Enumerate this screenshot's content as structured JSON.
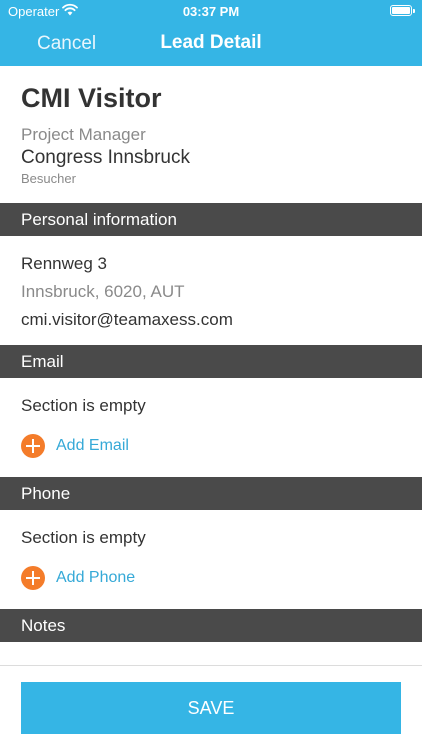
{
  "status_bar": {
    "carrier": "Operater",
    "time": "03:37 PM"
  },
  "nav": {
    "cancel_label": "Cancel",
    "title": "Lead Detail"
  },
  "lead": {
    "name": "CMI Visitor",
    "job_title": "Project Manager",
    "company": "Congress Innsbruck",
    "role": "Besucher"
  },
  "sections": {
    "personal": {
      "title": "Personal information",
      "street": "Rennweg 3",
      "city_line": "Innsbruck, 6020, AUT",
      "email": "cmi.visitor@teamaxess.com"
    },
    "email": {
      "title": "Email",
      "empty_text": "Section is empty",
      "add_label": "Add Email"
    },
    "phone": {
      "title": "Phone",
      "empty_text": "Section is empty",
      "add_label": "Add Phone"
    },
    "notes": {
      "title": "Notes"
    }
  },
  "save_label": "SAVE",
  "colors": {
    "accent": "#35b5e5",
    "section_bar": "#4a4a4a",
    "add_icon": "#f47c2a",
    "link": "#35a9d7"
  }
}
